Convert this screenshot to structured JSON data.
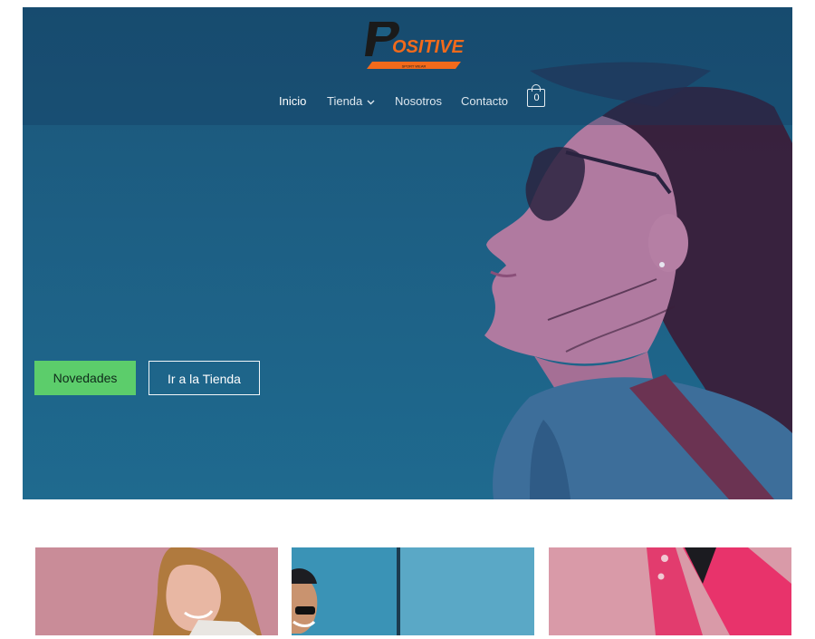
{
  "brand": {
    "name": "POSITIVE",
    "tagline": "SPORT WEAR",
    "colors": {
      "accent": "#f26a1b",
      "dark": "#1a1a1a"
    }
  },
  "nav": {
    "items": [
      {
        "label": "Inicio",
        "active": true
      },
      {
        "label": "Tienda",
        "has_dropdown": true,
        "icon": "chevron-down-icon"
      },
      {
        "label": "Nosotros"
      },
      {
        "label": "Contacto"
      }
    ],
    "cart": {
      "count": "0",
      "icon": "shopping-bag-icon"
    }
  },
  "hero": {
    "buttons": {
      "primary_label": "Novedades",
      "secondary_label": "Ir a la Tienda"
    },
    "colors": {
      "overlay": "#1d5f84",
      "primary_button": "#5ccd6b"
    }
  },
  "cards": [
    {
      "name": "woman-smiling",
      "bg": "#c98c98"
    },
    {
      "name": "man-sunglasses",
      "bg": "#3a93b6"
    },
    {
      "name": "pink-jacket",
      "bg": "#d99aa8"
    }
  ]
}
